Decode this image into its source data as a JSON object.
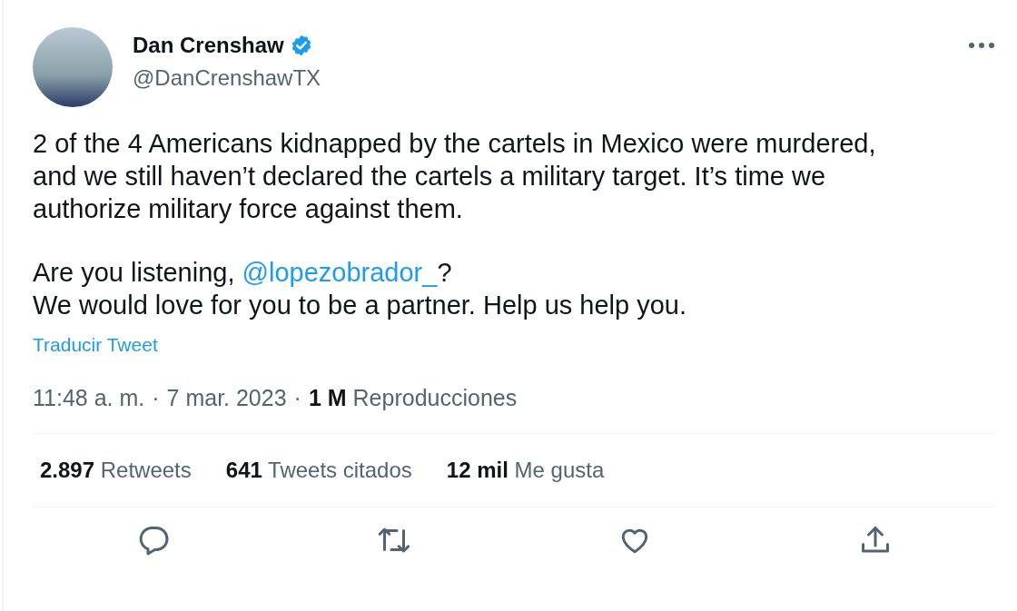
{
  "author": {
    "name": "Dan Crenshaw",
    "verified": true,
    "handle": "@DanCrenshawTX"
  },
  "body": [
    {
      "kind": "text",
      "text": "2 of the 4 Americans kidnapped by the cartels in Mexico were murdered, and we still haven’t declared the cartels a military target. It’s time we authorize military force against them."
    },
    {
      "kind": "mention",
      "before": "Are you listening, ",
      "mention": "@lopezobrador_",
      "after": "?"
    },
    {
      "kind": "line",
      "text": "We would love for you to be a partner. Help us help you."
    }
  ],
  "translate_link": "Traducir Tweet",
  "meta": {
    "time": "11:48 a. m.",
    "separator_1": "·",
    "date": "7 mar. 2023",
    "separator_2": "·",
    "views_count": "1 M",
    "views_label": "Reproducciones"
  },
  "stats": [
    {
      "count": "2.897",
      "label": "Retweets"
    },
    {
      "count": "641",
      "label": "Tweets citados"
    },
    {
      "count": "12 mil",
      "label": "Me gusta"
    }
  ],
  "actions": [
    {
      "kind": "reply"
    },
    {
      "kind": "retweet"
    },
    {
      "kind": "like"
    },
    {
      "kind": "share"
    }
  ]
}
